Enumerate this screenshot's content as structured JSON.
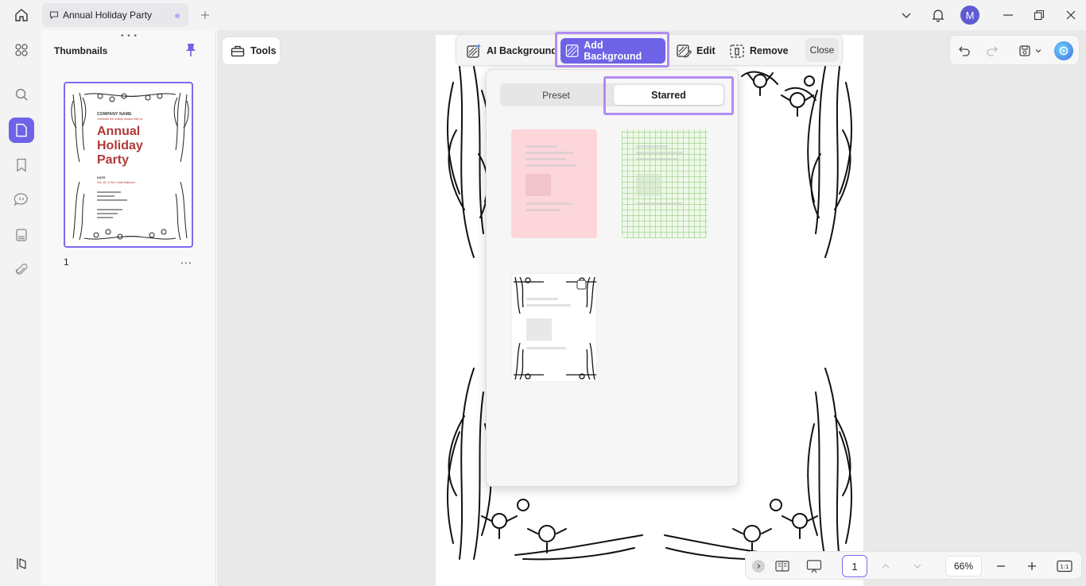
{
  "titlebar": {
    "tab_title": "Annual Holiday Party",
    "avatar_initial": "M"
  },
  "thumbnails": {
    "title": "Thumbnails",
    "page_number": "1",
    "more": "...",
    "preview": {
      "company": "COMPANY NAME",
      "subtitle": "Celebrate the holiday season with us",
      "title": "Annual Holiday Party",
      "date_label": "DATE",
      "date_value": "Dec 18 / 6 PM / Hotel Ballroom"
    }
  },
  "tools": {
    "label": "Tools"
  },
  "toolbar": {
    "ai_background": "AI Background",
    "add_background": "Add Background",
    "edit": "Edit",
    "remove": "Remove",
    "close": "Close"
  },
  "popup": {
    "tabs": {
      "preset": "Preset",
      "starred": "Starred"
    },
    "cards": [
      "pink-background",
      "green-grid-background",
      "floral-frame-background"
    ]
  },
  "bottombar": {
    "page": "1",
    "zoom": "66%",
    "fit": "1:1"
  },
  "colors": {
    "accent": "#6e63e6",
    "highlight": "#b18cf2",
    "title_red": "#b03a3a"
  }
}
